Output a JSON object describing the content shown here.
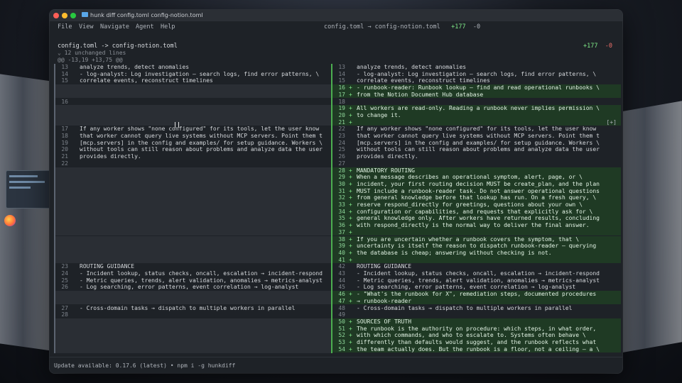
{
  "window": {
    "title": "hunk diff config.toml config-notion.toml",
    "menu": [
      "File",
      "View",
      "Navigate",
      "Agent",
      "Help"
    ],
    "summary": "config.toml → config-notion.toml",
    "summary_add": "+177",
    "summary_del": "-0"
  },
  "file": {
    "name": "config.toml -> config-notion.toml",
    "add": "+177",
    "del": "-0",
    "unchanged": "⌄ 12 unchanged lines",
    "hunk": "@@ -13,19 +13,75 @@"
  },
  "left_lines": [
    {
      "n": "13",
      "t": "analyze trends, detect anomalies",
      "k": "ctx"
    },
    {
      "n": "14",
      "t": "- log-analyst: Log investigation — search logs, find error patterns, \\",
      "k": "ctx"
    },
    {
      "n": "15",
      "t": "correlate events, reconstruct timelines",
      "k": "ctx"
    },
    {
      "n": "",
      "t": "",
      "k": "filler"
    },
    {
      "n": "",
      "t": "",
      "k": "filler"
    },
    {
      "n": "16",
      "t": "",
      "k": "ctx"
    },
    {
      "n": "",
      "t": "",
      "k": "filler"
    },
    {
      "n": "",
      "t": "",
      "k": "filler"
    },
    {
      "n": "",
      "t": "",
      "k": "filler"
    },
    {
      "n": "17",
      "t": "If any worker shows \"none configured\" for its tools, let the user know",
      "k": "ctx"
    },
    {
      "n": "18",
      "t": "that worker cannot query live systems without MCP servers. Point them t",
      "k": "ctx"
    },
    {
      "n": "19",
      "t": "[mcp.servers] in the config and examples/ for setup guidance. Workers \\",
      "k": "ctx"
    },
    {
      "n": "20",
      "t": "without tools can still reason about problems and analyze data the user",
      "k": "ctx"
    },
    {
      "n": "21",
      "t": "provides directly.",
      "k": "ctx"
    },
    {
      "n": "22",
      "t": "",
      "k": "ctx"
    },
    {
      "n": "",
      "t": "",
      "k": "filler"
    },
    {
      "n": "",
      "t": "",
      "k": "filler"
    },
    {
      "n": "",
      "t": "",
      "k": "filler"
    },
    {
      "n": "",
      "t": "",
      "k": "filler"
    },
    {
      "n": "",
      "t": "",
      "k": "filler"
    },
    {
      "n": "",
      "t": "",
      "k": "filler"
    },
    {
      "n": "",
      "t": "",
      "k": "filler"
    },
    {
      "n": "",
      "t": "",
      "k": "filler"
    },
    {
      "n": "",
      "t": "",
      "k": "filler"
    },
    {
      "n": "",
      "t": "",
      "k": "filler"
    },
    {
      "n": "",
      "t": "",
      "k": "filler"
    },
    {
      "n": "",
      "t": "",
      "k": "filler"
    },
    {
      "n": "",
      "t": "",
      "k": "filler"
    },
    {
      "n": "",
      "t": "",
      "k": "filler"
    },
    {
      "n": "23",
      "t": "ROUTING GUIDANCE",
      "k": "ctx"
    },
    {
      "n": "24",
      "t": "- Incident lookup, status checks, oncall, escalation → incident-respond",
      "k": "ctx"
    },
    {
      "n": "25",
      "t": "- Metric queries, trends, alert validation, anomalies → metrics-analyst",
      "k": "ctx"
    },
    {
      "n": "26",
      "t": "- Log searching, error patterns, event correlation → log-analyst",
      "k": "ctx"
    },
    {
      "n": "",
      "t": "",
      "k": "filler"
    },
    {
      "n": "",
      "t": "",
      "k": "filler"
    },
    {
      "n": "27",
      "t": "- Cross-domain tasks → dispatch to multiple workers in parallel",
      "k": "ctx"
    },
    {
      "n": "28",
      "t": "",
      "k": "ctx"
    },
    {
      "n": "",
      "t": "",
      "k": "filler"
    },
    {
      "n": "",
      "t": "",
      "k": "filler"
    },
    {
      "n": "",
      "t": "",
      "k": "filler"
    },
    {
      "n": "",
      "t": "",
      "k": "filler"
    },
    {
      "n": "",
      "t": "",
      "k": "filler"
    },
    {
      "n": "",
      "t": "",
      "k": "filler"
    }
  ],
  "right_lines": [
    {
      "n": "13",
      "t": "analyze trends, detect anomalies",
      "k": "ctx"
    },
    {
      "n": "14",
      "t": "- log-analyst: Log investigation — search logs, find error patterns, \\",
      "k": "ctx"
    },
    {
      "n": "15",
      "t": "correlate events, reconstruct timelines",
      "k": "ctx"
    },
    {
      "n": "16",
      "t": "- runbook-reader: Runbook lookup — find and read operational runbooks \\",
      "k": "add"
    },
    {
      "n": "17",
      "t": "from the Notion Document Hub database",
      "k": "add"
    },
    {
      "n": "18",
      "t": "",
      "k": "ctx"
    },
    {
      "n": "19",
      "t": "All workers are read-only. Reading a runbook never implies permission \\",
      "k": "add"
    },
    {
      "n": "20",
      "t": "to change it.",
      "k": "add"
    },
    {
      "n": "21",
      "t": "",
      "k": "add",
      "x": "[+]"
    },
    {
      "n": "22",
      "t": "If any worker shows \"none configured\" for its tools, let the user know",
      "k": "ctx"
    },
    {
      "n": "23",
      "t": "that worker cannot query live systems without MCP servers. Point them t",
      "k": "ctx"
    },
    {
      "n": "24",
      "t": "[mcp.servers] in the config and examples/ for setup guidance. Workers \\",
      "k": "ctx"
    },
    {
      "n": "25",
      "t": "without tools can still reason about problems and analyze data the user",
      "k": "ctx"
    },
    {
      "n": "26",
      "t": "provides directly.",
      "k": "ctx"
    },
    {
      "n": "27",
      "t": "",
      "k": "ctx"
    },
    {
      "n": "28",
      "t": "MANDATORY ROUTING",
      "k": "add"
    },
    {
      "n": "29",
      "t": "When a message describes an operational symptom, alert, page, or \\",
      "k": "add"
    },
    {
      "n": "30",
      "t": "incident, your first routing decision MUST be create_plan, and the plan",
      "k": "add"
    },
    {
      "n": "31",
      "t": "MUST include a runbook-reader task. Do not answer operational questions",
      "k": "add"
    },
    {
      "n": "32",
      "t": "from general knowledge before that lookup has run. On a fresh query, \\",
      "k": "add"
    },
    {
      "n": "33",
      "t": "reserve respond_directly for greetings, questions about your own \\",
      "k": "add"
    },
    {
      "n": "34",
      "t": "configuration or capabilities, and requests that explicitly ask for \\",
      "k": "add"
    },
    {
      "n": "35",
      "t": "general knowledge only. After workers have returned results, concluding",
      "k": "add"
    },
    {
      "n": "36",
      "t": "with respond_directly is the normal way to deliver the final answer.",
      "k": "add"
    },
    {
      "n": "37",
      "t": "",
      "k": "add"
    },
    {
      "n": "38",
      "t": "If you are uncertain whether a runbook covers the symptom, that \\",
      "k": "add"
    },
    {
      "n": "39",
      "t": "uncertainty is itself the reason to dispatch runbook-reader — querying",
      "k": "add"
    },
    {
      "n": "40",
      "t": "the database is cheap; answering without checking is not.",
      "k": "add"
    },
    {
      "n": "41",
      "t": "",
      "k": "add"
    },
    {
      "n": "42",
      "t": "ROUTING GUIDANCE",
      "k": "ctx"
    },
    {
      "n": "43",
      "t": "- Incident lookup, status checks, oncall, escalation → incident-respond",
      "k": "ctx"
    },
    {
      "n": "44",
      "t": "- Metric queries, trends, alert validation, anomalies → metrics-analyst",
      "k": "ctx"
    },
    {
      "n": "45",
      "t": "- Log searching, error patterns, event correlation → log-analyst",
      "k": "ctx"
    },
    {
      "n": "46",
      "t": "- \"What's the runbook for X\", remediation steps, documented procedures",
      "k": "add"
    },
    {
      "n": "47",
      "t": "→ runbook-reader",
      "k": "add"
    },
    {
      "n": "48",
      "t": "- Cross-domain tasks → dispatch to multiple workers in parallel",
      "k": "ctx"
    },
    {
      "n": "49",
      "t": "",
      "k": "ctx"
    },
    {
      "n": "50",
      "t": "SOURCES OF TRUTH",
      "k": "add"
    },
    {
      "n": "51",
      "t": "The runbook is the authority on procedure: which steps, in what order, ",
      "k": "add"
    },
    {
      "n": "52",
      "t": "with which commands, and who to escalate to. Systems often behave \\",
      "k": "add"
    },
    {
      "n": "53",
      "t": "differently than defaults would suggest, and the runbook reflects what",
      "k": "add"
    },
    {
      "n": "54",
      "t": "the team actually does. But the runbook is a floor, not a ceiling — a \\",
      "k": "add"
    }
  ],
  "status": "Update available: 0.17.6 (latest) • npm i -g hunkdiff"
}
